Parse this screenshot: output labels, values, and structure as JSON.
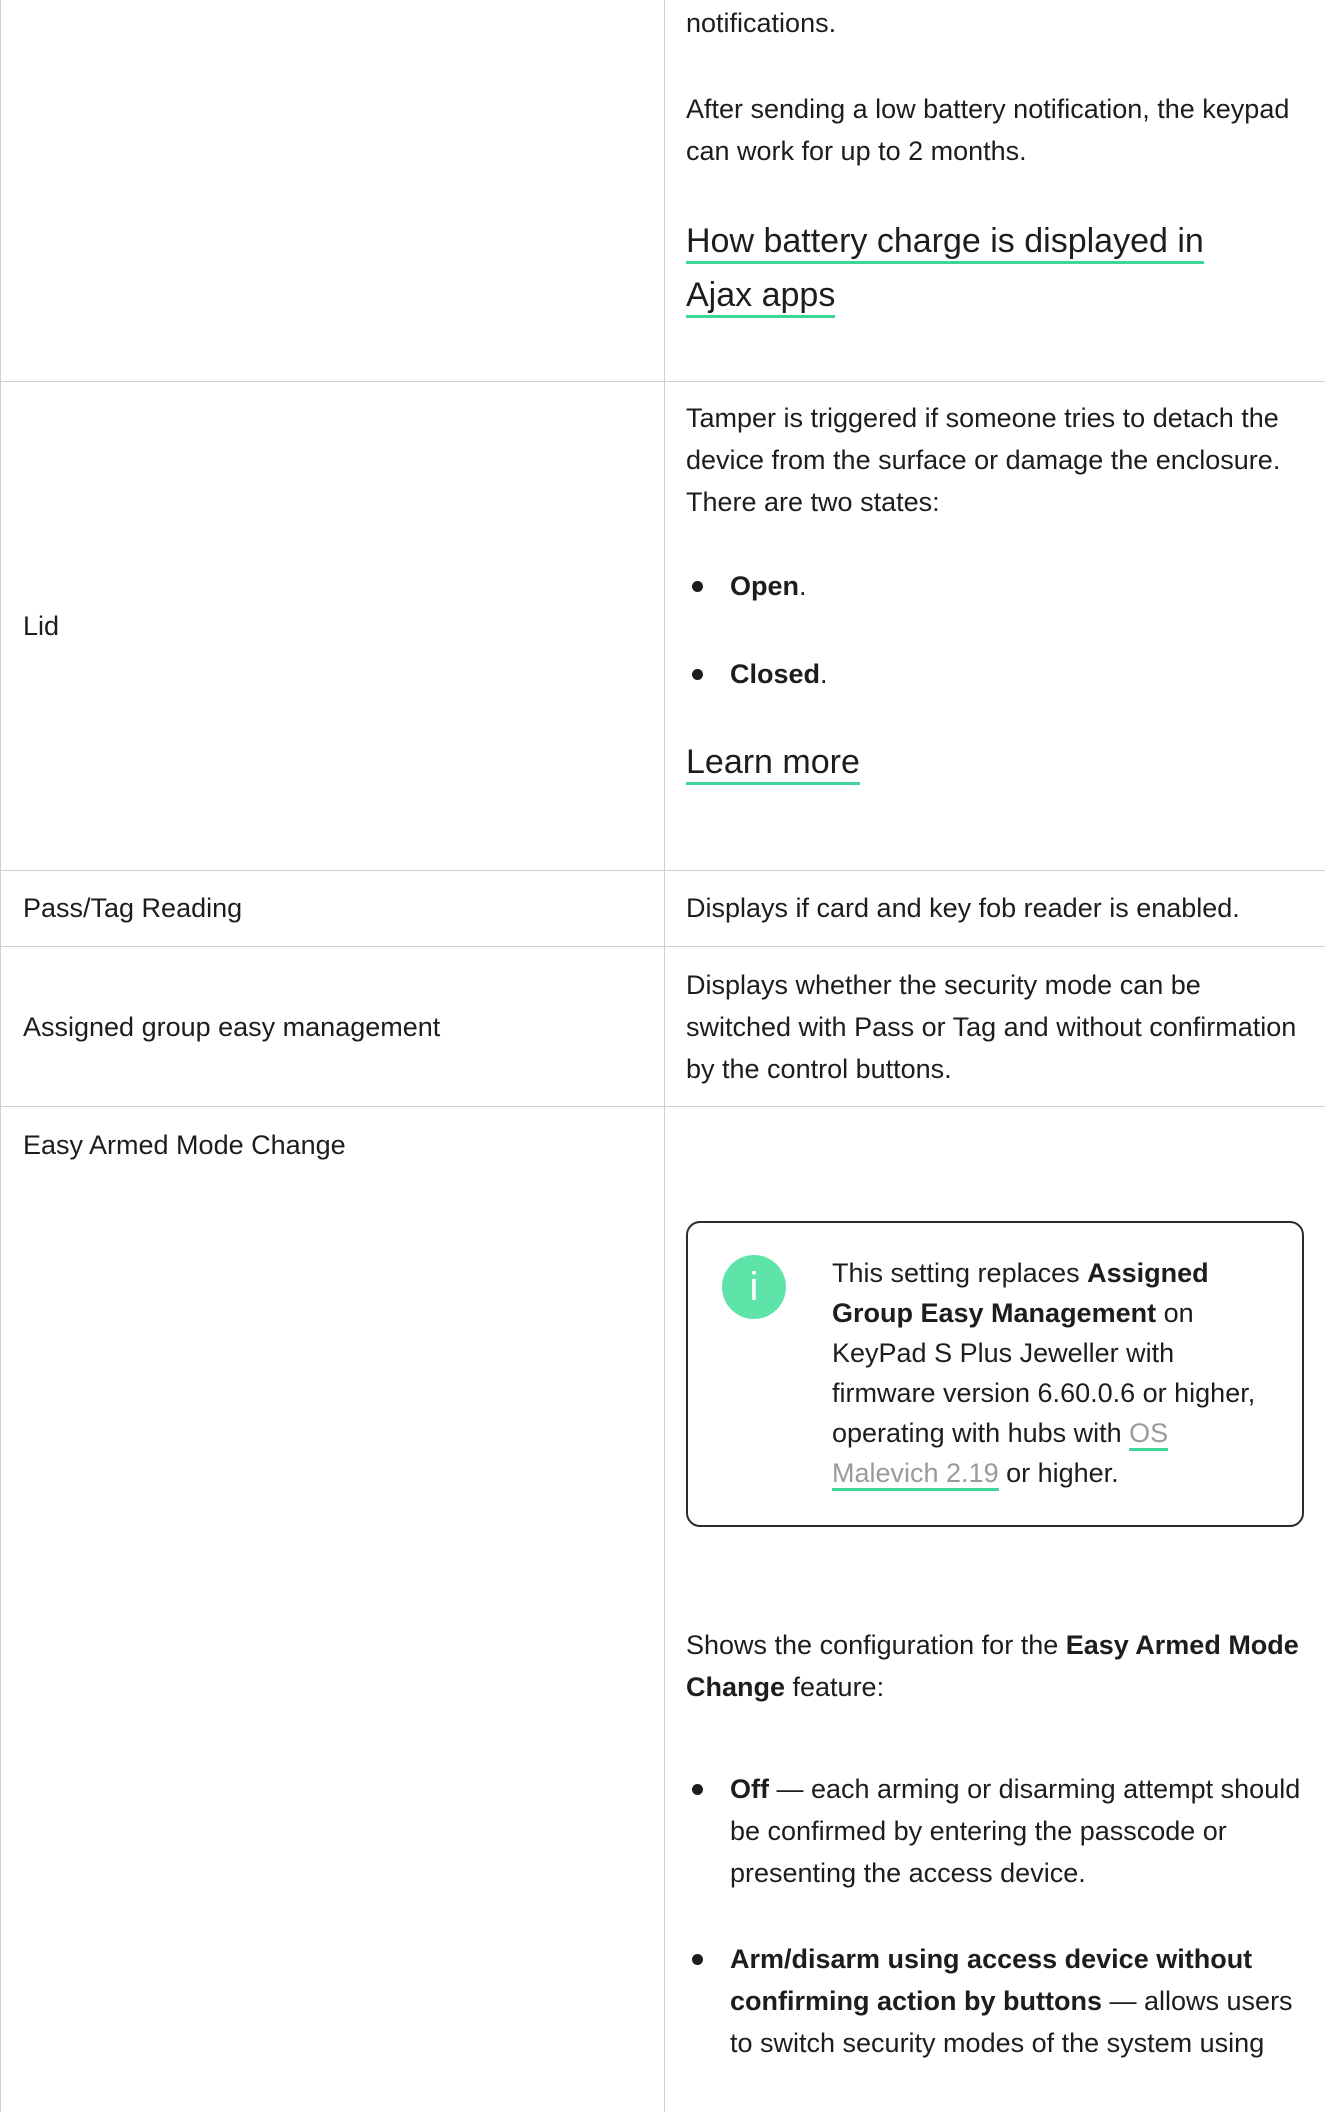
{
  "battery": {
    "line1": "notifications.",
    "para": "After sending a low battery notification, the keypad can work for up to 2 months.",
    "link": "How battery charge is displayed in Ajax apps"
  },
  "lid": {
    "label": "Lid",
    "desc": "Tamper is triggered if someone tries to detach the device from the surface or damage the enclosure. There are two states:",
    "states": [
      {
        "name": "Open",
        "suffix": "."
      },
      {
        "name": "Closed",
        "suffix": "."
      }
    ],
    "link": "Learn more"
  },
  "pass_tag": {
    "label": "Pass/Tag Reading",
    "desc": "Displays if card and key fob reader is enabled."
  },
  "assigned_group": {
    "label": "Assigned group easy management",
    "desc": "Displays whether the security mode can be switched with Pass or Tag and without confirmation by the control buttons."
  },
  "easy_armed": {
    "label": "Easy Armed Mode Change",
    "note": {
      "icon": "info-icon",
      "part1": "This setting replaces ",
      "bold1": "Assigned Group Easy Management",
      "part2": " on KeyPad S Plus Jeweller with firmware version 6.60.0.6 or higher, operating with hubs with ",
      "link": "OS Malevich 2.19",
      "part3": " or higher."
    },
    "intro_part1": "Shows the configuration for the ",
    "intro_bold": "Easy Armed Mode Change",
    "intro_part2": " feature:",
    "options": [
      {
        "name": "Off",
        "desc": " — each arming or disarming attempt should be confirmed by entering the passcode or presenting the access device."
      },
      {
        "name": "Arm/disarm using access device without confirming action by buttons",
        "desc": " — allows users to switch security modes of the system using"
      }
    ]
  },
  "colors": {
    "accent": "#3dd598",
    "info_icon": "#5ee3a8",
    "border": "#cfcfcf"
  }
}
